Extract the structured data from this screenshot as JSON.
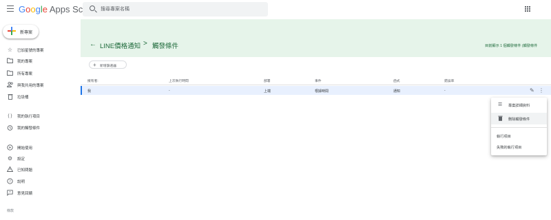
{
  "header": {
    "menu_icon": "hamburger-menu-icon",
    "logo": {
      "g": "G",
      "o1": "o",
      "o2": "o",
      "g2": "g",
      "l": "l",
      "e": "e",
      "rest": " Apps Script"
    },
    "search_placeholder": "搜尋專案名稱",
    "apps_icon": "apps-grid-icon"
  },
  "sidebar": {
    "new_button": "新專案",
    "items": [
      {
        "label": "已加星號的專案",
        "icon": "star-icon"
      },
      {
        "label": "我的專案",
        "icon": "folder-icon"
      },
      {
        "label": "所有專案",
        "icon": "folder-icon"
      },
      {
        "label": "與我共用的專案",
        "icon": "people-icon"
      },
      {
        "label": "垃圾桶",
        "icon": "trash-icon"
      },
      {
        "label": "我的執行項目",
        "icon": "executions-icon"
      },
      {
        "label": "我的觸發條件",
        "icon": "alarm-icon"
      },
      {
        "label": "開始使用",
        "icon": "play-icon"
      },
      {
        "label": "設定",
        "icon": "gear-icon"
      },
      {
        "label": "已知問題",
        "icon": "warning-icon"
      },
      {
        "label": "說明",
        "icon": "help-icon"
      },
      {
        "label": "意見回饋",
        "icon": "feedback-icon"
      }
    ],
    "footer": "條款"
  },
  "banner": {
    "project": "LINE價格通知",
    "separator": ">",
    "page": "觸發條件",
    "right_text": "目前顯示 1 個觸發條件 (觸發條件"
  },
  "toolbar": {
    "add_trigger": "新增篩選器"
  },
  "table": {
    "columns": [
      "擁有者:",
      "上次執行時間",
      "部署",
      "事件",
      "函式",
      "錯誤率"
    ],
    "rows": [
      {
        "owner": "我",
        "last_run": "-",
        "deployment": "上端",
        "event": "根據時間",
        "function": "通知",
        "error_rate": "-"
      }
    ]
  },
  "context_menu": {
    "items": [
      {
        "label": "專案詳細資料",
        "icon": "list-icon"
      },
      {
        "label": "刪除觸發條件",
        "icon": "trash-icon"
      },
      {
        "label": "執行項目"
      },
      {
        "label": "失敗的執行項目"
      }
    ]
  }
}
